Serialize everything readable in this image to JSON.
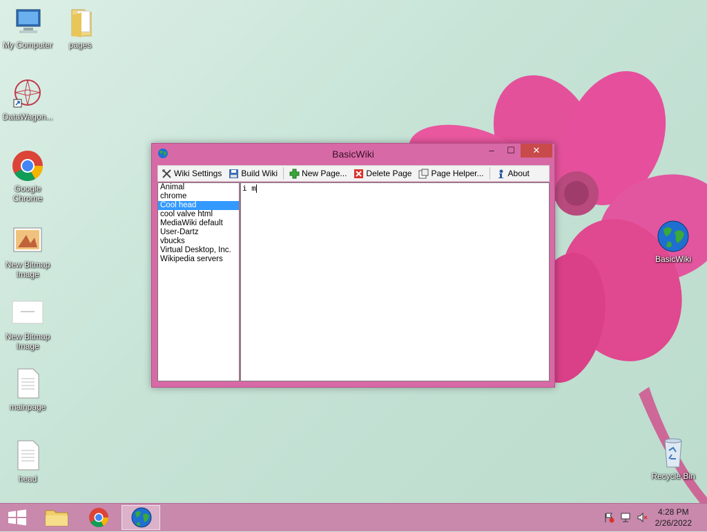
{
  "desktop": {
    "icons": [
      {
        "label": "My Computer"
      },
      {
        "label": "pages"
      },
      {
        "label": "DataWagon..."
      },
      {
        "label": "Google Chrome"
      },
      {
        "label": "New Bitmap Image"
      },
      {
        "label": "New Bitmap Image"
      },
      {
        "label": "mainpage"
      },
      {
        "label": "head"
      },
      {
        "label": "BasicWiki"
      },
      {
        "label": "Recycle Bin"
      }
    ]
  },
  "window": {
    "title": "BasicWiki",
    "controls": {
      "minimize": "–",
      "maximize": "☐",
      "close": "✕"
    },
    "toolbar": {
      "wiki_settings": "Wiki Settings",
      "build_wiki": "Build Wiki",
      "new_page": "New Page...",
      "delete_page": "Delete Page",
      "page_helper": "Page Helper...",
      "about": "About"
    },
    "pages": [
      "Animal",
      "chrome",
      "Cool head",
      "cool valve html",
      "MediaWiki default",
      "User-Dartz",
      "vbucks",
      "Virtual Desktop, Inc.",
      "Wikipedia servers"
    ],
    "selected_page": "Cool head",
    "editor_text": "i m"
  },
  "taskbar": {
    "time": "4:28 PM",
    "date": "2/26/2022"
  },
  "colors": {
    "window_frame": "#d76aa6",
    "taskbar": "#c889ad",
    "selection": "#3399ff",
    "close_button": "#c94a4a"
  }
}
